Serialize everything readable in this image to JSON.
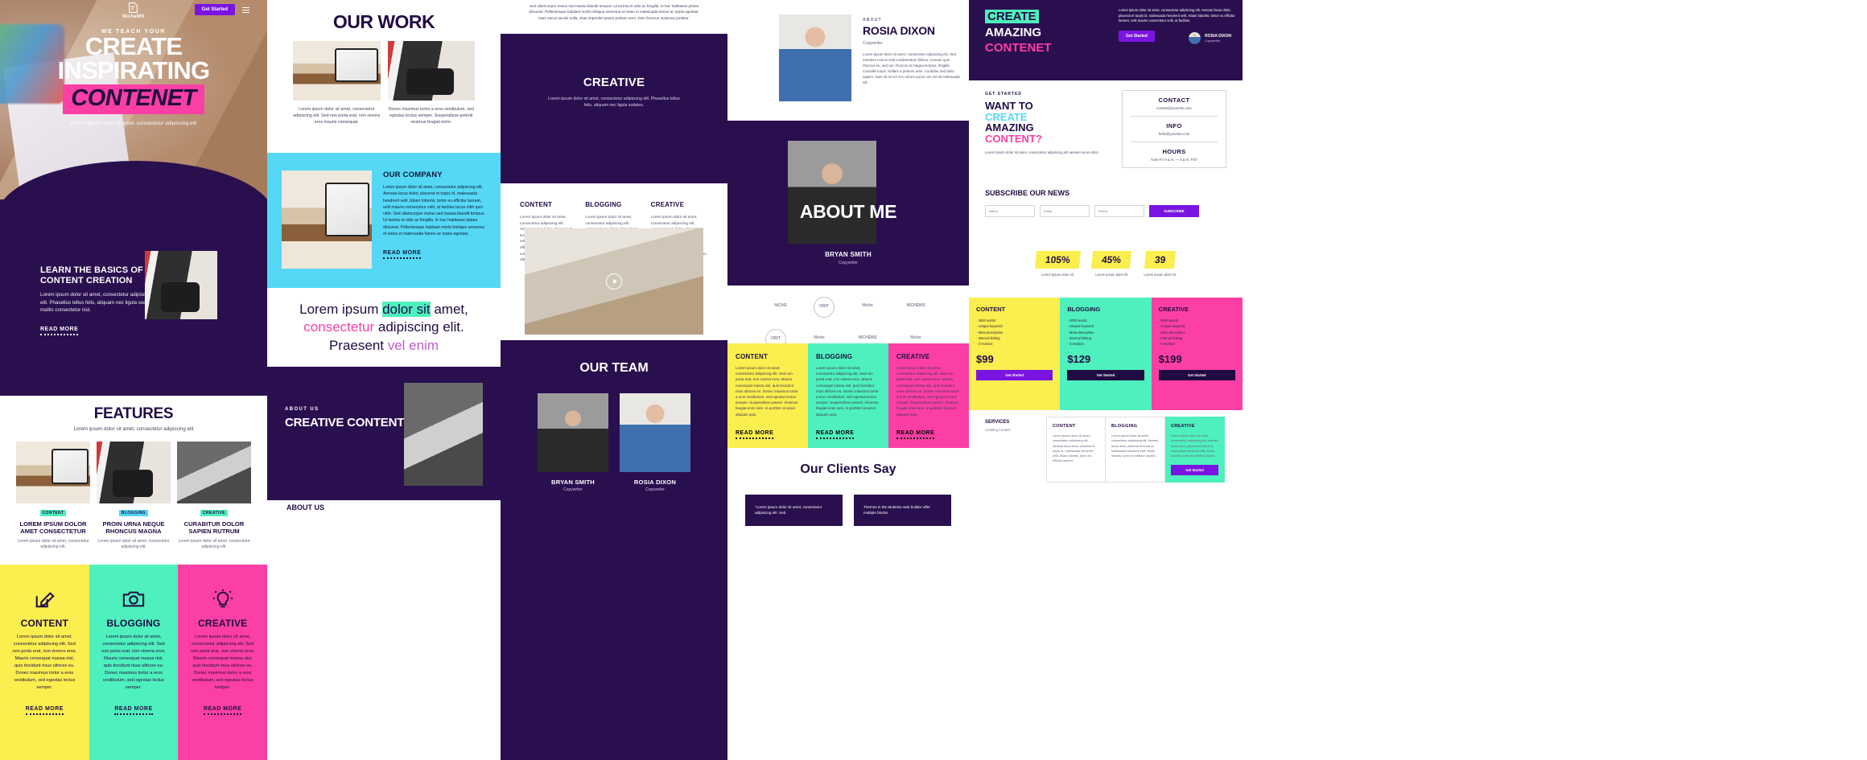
{
  "brand": {
    "name": "NicheMS",
    "cta": "Get Started"
  },
  "colors": {
    "dark_purple": "#2a0f4e",
    "navy": "#210b43",
    "pink": "#fb3fa5",
    "cyan": "#55d8f5",
    "mint": "#4ef0bd",
    "yellow": "#fbee4f",
    "violet": "#7a14e0"
  },
  "hero": {
    "kicker": "WE TEACH YOUR",
    "line1": "CREATE",
    "line2": "INSPIRATING",
    "line3": "CONTENET",
    "subtitle": "Lorem ipsum dolor sit amet, consectetur adipiscing elit"
  },
  "learn": {
    "title": "LEARN THE BASICS OF CONTENT CREATION",
    "body": "Lorem ipsum dolor sit amet, consectetur adipiscing elit. Phasellus tellus felis, aliquam nec ligula sodales, mattis consectetur nisl.",
    "read_more": "READ MORE"
  },
  "features": {
    "title": "FEATURES",
    "subtitle": "Lorem ipsum dolor sit amet, consectetur adipiscing elit",
    "cards": [
      {
        "tag": "CONTENT",
        "title": "LOREM IPSUM DOLOR AMET CONSECTETUR",
        "body": "Lorem ipsum dolor sit amet, consectetur adipiscing elit."
      },
      {
        "tag": "BLOGGING",
        "title": "PROIN URNA NEQUE RHONCUS MAGNA",
        "body": "Lorem ipsum dolor sit amet, consectetur adipiscing elit."
      },
      {
        "tag": "CREATIVE",
        "title": "CURABITUR DOLOR SAPIEN RUTRUM",
        "body": "Lorem ipsum dolor sit amet, consectetur adipiscing elit."
      }
    ]
  },
  "service_cards": [
    {
      "icon": "pencil-square-icon",
      "title": "CONTENT",
      "body": "Lorem ipsum dolor sit amet, consectetur adipiscing elit. Sed non porta erat, non viverra eros. Mauris consequat massa nisl, quis tincidunt risus ultrices eu. Donec maximus tortor a eros vestibulum, sed egestas lectus semper.",
      "read_more": "READ MORE",
      "bg": "#fbee4f"
    },
    {
      "icon": "camera-icon",
      "title": "BLOGGING",
      "body": "Lorem ipsum dolor sit amet, consectetur adipiscing elit. Sed non porta erat, non viverra eros. Mauris consequat massa nisl, quis tincidunt risus ultrices eu. Donec maximus tortor a eros vestibulum, sed egestas lectus semper.",
      "read_more": "READ MORE",
      "bg": "#4ef0bd"
    },
    {
      "icon": "lightbulb-icon",
      "title": "CREATIVE",
      "body": "Lorem ipsum dolor sit amet, consectetur adipiscing elit. Sed non porta erat, non viverra eros. Mauris consequat massa nisl, quis tincidunt risus ultrices eu. Donec maximus tortor a eros vestibulum, sed egestas lectus semper.",
      "read_more": "READ MORE",
      "bg": "#fb3fa5"
    }
  ],
  "our_work": {
    "title": "OUR WORK",
    "items": [
      {
        "caption": "Lorem ipsum dolor sit amet, consectetur adipiscing elit. Sed non porta erat, non viverra eros mauris consequat."
      },
      {
        "caption": "Donec maximus tortor a eros vestibulum, sed egestas lectus semper. Suspendisse potenti vivamus feugiat enim."
      }
    ]
  },
  "our_company": {
    "title": "OUR COMPANY",
    "body": "Lorem ipsum dolor sit amet, consectetur adipiscing elit. Aenean lacus dolor, placerat et turpis id, malesuada hendrerit velit. Etiam lobortis, tortor eu efficitur laoreet, velit mauris consectetur velit, at facilisis lacus nibh quis nibh. Sed ullamcorper metus sed massa blandit tempus. Ut lacinia et odio ac fringilla. In hac habitasse platea dictumst. Pellentesque habitant morbi tristique senectus et netus et malesuada fames ac turpis egestas.",
    "read_more": "READ MORE"
  },
  "big_quote": {
    "part1": "Lorem ipsum ",
    "hl": "dolor sit",
    "part2": " amet,",
    "pink": "consectetur",
    "part3": " adipiscing elit.",
    "part4": "Praesent ",
    "violet": "vel enim"
  },
  "about_us": {
    "kicker": "ABOUT US",
    "title": "CREATIVE CONTENT CREATORS",
    "footer_label": "ABOUT US"
  },
  "top_para": "Sed ullamcorper metus sed massa blandit tempus. Ut lacinia et odio ac fringilla. In hac habitasse platea dictumst. Pellentesque habitant morbi tristique senectus et netus et malesuada fames ac turpis egestas. Nam sacus iaculis nulla, vitae imperdiet ipsum pretium sem. Duis rhoncus maximus porttitor.",
  "creative_block": {
    "title": "CREATIVE",
    "body": "Lorem ipsum dolor sit amet, consectetur adipiscing elit. Phasellus tellus felis, aliquam nec ligula sodales."
  },
  "three_cols": [
    {
      "title": "CONTENT",
      "body": "Lorem ipsum dolor sit amet, consectetur adipiscing elit. Aenean lacus dolor, placerat et turpis id, malesuada hendrerit velit. Etiam lobortis, tortor eu efficitur laoreet, velit mauris consectetur velit, at facilisis lacus nibh quis nibh."
    },
    {
      "title": "BLOGGING",
      "body": "Lorem ipsum dolor sit amet, consectetur adipiscing elit. Aenean lacus dolor, placerat et turpis id, malesuada hendrerit velit. Etiam lobortis, tortor eu efficitur laoreet, velit mauris consectetur velit, at facilisis lacus nibh quis nibh."
    },
    {
      "title": "CREATIVE",
      "body": "Lorem ipsum dolor sit amet, consectetur adipiscing elit. Aenean lacus dolor, placerat et turpis id, malesuada hendrerit velit. Etiam lobortis, tortor eu efficitur laoreet, velit mauris consectetur velit, at facilisis lacus nibh quis nibh."
    }
  ],
  "our_team": {
    "title": "OUR TEAM",
    "members": [
      {
        "name": "BRYAN SMITH",
        "role": "Copywriter"
      },
      {
        "name": "ROSIA DIXON",
        "role": "Copywriter"
      }
    ]
  },
  "profile_rosia": {
    "kicker": "ABOUT",
    "name": "ROSIA DIXON",
    "role": "Copywriter",
    "body": "Lorem ipsum dolor sit amet, consectetur adipiscing elit. Sed interdum erat at velit condimentum finibus. Aenean quis rhoncus ex, sed nec rhoncus at magna tempus, fringilla convallis turpis. Nullam a pretium ante. Curabitur sed dolor sapien. Nam sit sit vel orci rutrum purus non vel sit malesuada elit."
  },
  "about_me": {
    "title": "ABOUT ME",
    "name": "BRYAN SMITH",
    "role": "Copywriter"
  },
  "client_logos": [
    "NICHE",
    "ORIT",
    "Niche",
    "NICHEMS",
    "ORIT",
    "Niche",
    "NICHEMS",
    "Niche"
  ],
  "pricing_blurbs": [
    {
      "title": "CONTENT",
      "body": "Lorem ipsum dolor sit amet, consectetur adipiscing elit. Sed non porta erat, non viverra eros. Mauris consequat massa nisl, quis tincidunt risus ultrices eu. Donec maximus tortor a eros vestibulum, sed egestas lectus semper. Suspendisse potenti. Vivamus feugiat enim sem. In porttitor sit amet aliquam quis.",
      "read_more": "READ MORE",
      "bg": "#fbee4f"
    },
    {
      "title": "BLOGGING",
      "body": "Lorem ipsum dolor sit amet, consectetur adipiscing elit. Sed non porta erat, non viverra eros. Mauris consequat massa nisl, quis tincidunt risus ultrices eu. Donec maximus tortor a eros vestibulum, sed egestas lectus semper. Suspendisse potenti. Vivamus feugiat enim sem. In porttitor sit amet aliquam quis.",
      "read_more": "READ MORE",
      "bg": "#4ef0bd"
    },
    {
      "title": "CREATIVE",
      "body": "Lorem ipsum dolor sit amet, consectetur adipiscing elit. Sed non porta erat, non viverra eros. Mauris consequat massa nisl, quis tincidunt risus ultrices eu. Donec maximus tortor a eros vestibulum, sed egestas lectus semper. Suspendisse potenti. Vivamus feugiat enim sem. In porttitor sit amet aliquam quis.",
      "read_more": "READ MORE",
      "bg": "#fb3fa5"
    }
  ],
  "clients_say": {
    "title": "Our Clients Say",
    "quotes": [
      "\"Lorem ipsum dolor sit amet, consectetur adipiscing elit. Sed",
      "Themes in the Mobirise web builder offer multiple blocks"
    ]
  },
  "promo": {
    "word1": "CREATE",
    "word2": "AMAZING",
    "word3": "CONTENET",
    "body": "Lorem ipsum dolor sit amet, consectetur adipiscing elit. Aenean lacus dolor, placerat et turpis id, malesuada hendrerit velit. Etiam lobortis, tortor eu efficitur laoreet, velit mauris consectetur velit, at facilisis.",
    "button": "Get Started",
    "person_name": "ROSIA DIXON",
    "person_role": "Copywriter"
  },
  "want_to": {
    "kicker": "GET STARTED",
    "l1": "WANT TO",
    "l2": "CREATE",
    "l3": "AMAZING",
    "l4": "CONTENT?",
    "body": "Lorem ipsum dolor sit amet, consectetur adipiscing elit aenean lacus dolor.",
    "contact": {
      "label": "CONTACT",
      "value": "contact@yoursite.com"
    },
    "info": {
      "label": "INFO",
      "value": "hello@yoursite.com"
    },
    "hours": {
      "label": "HOURS",
      "value": "Tues-Fri 9 a.m. — 6 p.m. PST"
    }
  },
  "subscribe": {
    "title": "SUBSCRIBE OUR NEWS",
    "name_placeholder": "Name",
    "email_placeholder": "Email",
    "phone_placeholder": "Phone",
    "button": "SUBSCRIBE"
  },
  "stats": [
    {
      "value": "105%",
      "caption": "Lorem ipsum dolor sit"
    },
    {
      "value": "45%",
      "caption": "Lorem ipsum dolor sit"
    },
    {
      "value": "39",
      "caption": "Lorem ipsum dolor sit"
    }
  ],
  "plans": [
    {
      "title": "CONTENT",
      "features": [
        "3000 words",
        "Unique keyword",
        "Meta description",
        "Internal linking",
        "3 revision"
      ],
      "price": "$99",
      "button": "Get Started",
      "bg": "#fbee4f",
      "btn_bg": "#7a14e0"
    },
    {
      "title": "BLOGGING",
      "features": [
        "4000 words",
        "Unique keyword",
        "Meta description",
        "Internal linking",
        "3 revision"
      ],
      "price": "$129",
      "button": "Get Started",
      "bg": "#4ef0bd",
      "btn_bg": "#210b43"
    },
    {
      "title": "CREATIVE",
      "features": [
        "6000 words",
        "Unique keyword",
        "Meta description",
        "Internal linking",
        "5 revision"
      ],
      "price": "$199",
      "button": "Get Started",
      "bg": "#fb3fa5",
      "btn_bg": "#210b43"
    }
  ],
  "services_table": {
    "label": "SERVICES",
    "sub": "Creating Content",
    "columns": [
      {
        "head": "CONTENT",
        "body": "Lorem ipsum dolor sit amet, consectetur adipiscing elit. Aenean lacus dolor, placerat et turpis id, malesuada hendrerit velit. Etiam lobortis, tortor eu efficitur laoreet."
      },
      {
        "head": "BLOGGING",
        "body": "Lorem ipsum dolor sit amet, consectetur adipiscing elit. Aenean lacus dolor, placerat et turpis id, malesuada hendrerit velit. Etiam lobortis, tortor eu efficitur laoreet."
      },
      {
        "head": "CREATIVE",
        "body": "Lorem ipsum dolor sit amet, consectetur adipiscing elit. Aenean lacus dolor, placerat et turpis id, malesuada hendrerit velit. Etiam lobortis, tortor eu efficitur laoreet.",
        "button": "Get Started"
      }
    ]
  }
}
